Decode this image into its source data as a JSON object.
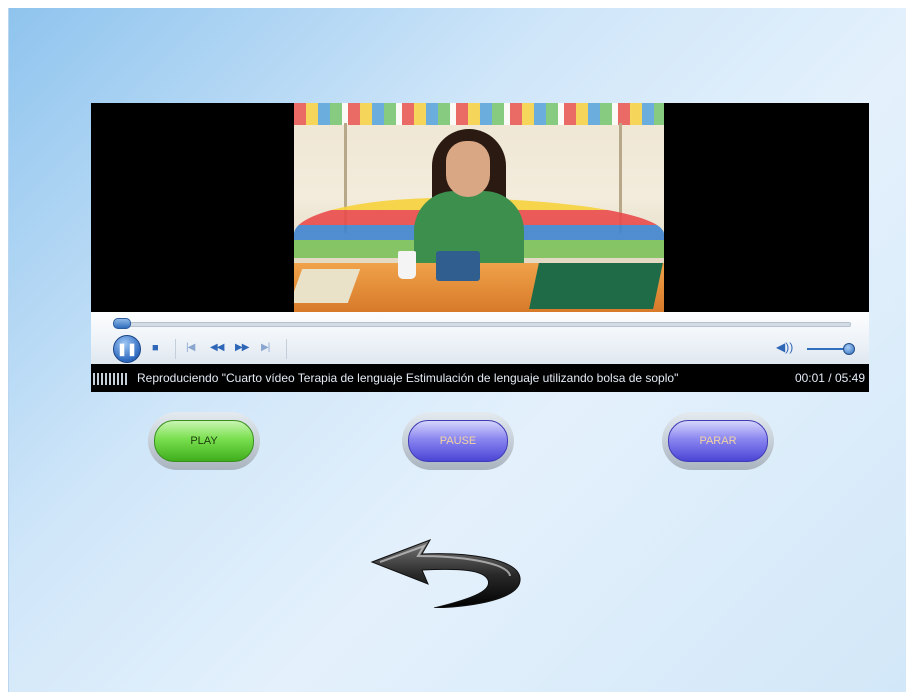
{
  "player": {
    "status_text": "Reproduciendo \"Cuarto vídeo Terapia de lenguaje Estimulación de lenguaje utilizando bolsa de soplo\"",
    "time_display": "00:01 / 05:49",
    "progress_fraction": 0.003,
    "volume_fraction": 1.0,
    "icons": {
      "pause": "pause-icon",
      "stop": "stop-icon",
      "previous": "skip-previous-icon",
      "rewind": "rewind-icon",
      "fast_forward": "fast-forward-icon",
      "next": "skip-next-icon",
      "volume": "volume-icon"
    }
  },
  "buttons": {
    "play_label": "PLAY",
    "pause_label": "PAUSE",
    "stop_label": "PARAR"
  },
  "colors": {
    "play_green": "#5fcc36",
    "pause_purple": "#7a75ea",
    "stop_purple": "#7a75ea",
    "accent_blue": "#2f6fbf"
  },
  "navigation": {
    "back_icon": "back-arrow-icon"
  }
}
